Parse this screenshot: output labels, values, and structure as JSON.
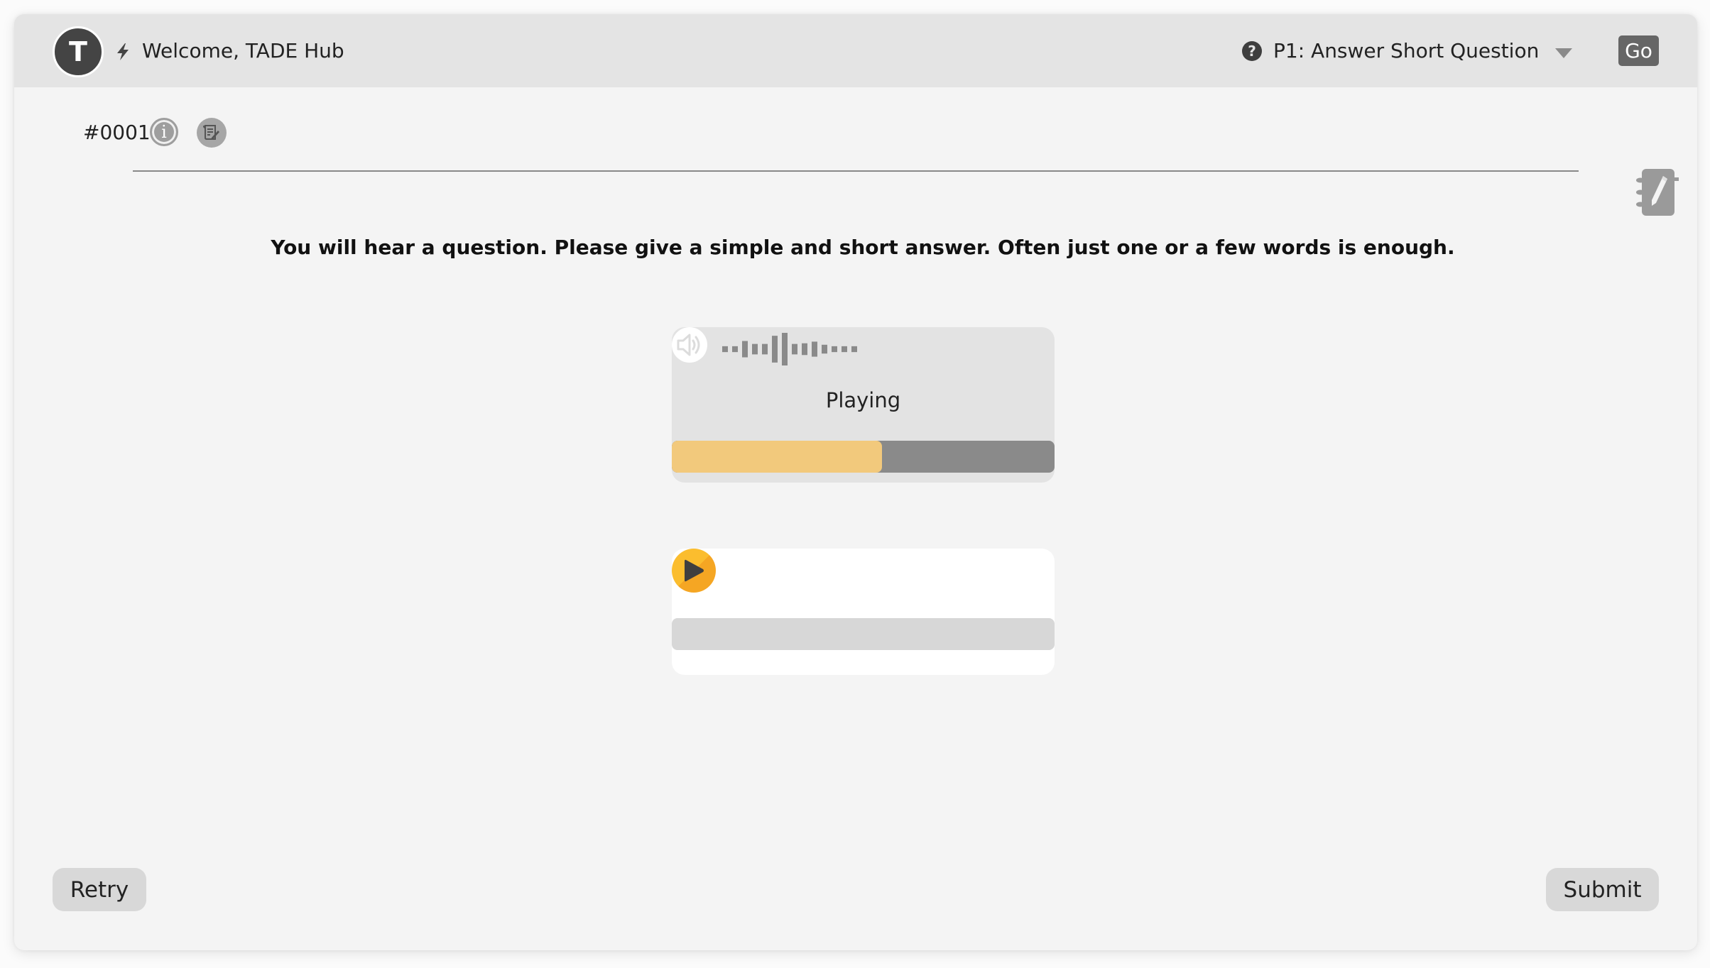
{
  "header": {
    "avatar_initial": "T",
    "welcome_text": "Welcome, TADE Hub",
    "task_selector": {
      "selected": "P1: Answer Short Question"
    },
    "go_label": "Go"
  },
  "question": {
    "id": "#0001",
    "instruction": "You will hear a question. Please give a simple and short answer. Often just one or a few words is enough."
  },
  "prompt_player": {
    "status": "Playing",
    "progress": 0.55,
    "waveform_levels": [
      0.18,
      0.18,
      0.5,
      0.32,
      0.32,
      0.82,
      1.0,
      0.32,
      0.36,
      0.46,
      0.27,
      0.18,
      0.18,
      0.18
    ]
  },
  "response_recorder": {
    "progress": 0.0
  },
  "footer": {
    "retry_label": "Retry",
    "submit_label": "Submit"
  },
  "colors": {
    "progress_fill": "#f2c97c",
    "progress_track": "#8a8a8a",
    "play_button": "#fbbd2e",
    "go_button": "#666666",
    "header_bg": "#e4e4e4"
  }
}
